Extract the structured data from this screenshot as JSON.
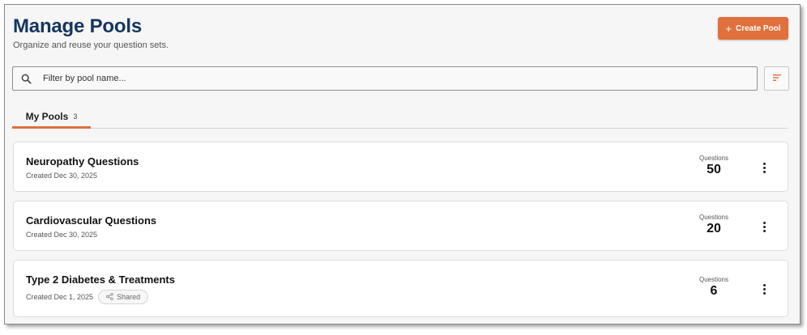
{
  "header": {
    "title": "Manage Pools",
    "subtitle": "Organize and reuse your question sets.",
    "create_button": "Create Pool"
  },
  "search": {
    "placeholder": "Filter by pool name..."
  },
  "tabs": [
    {
      "label": "My Pools",
      "count": "3"
    }
  ],
  "pools": [
    {
      "name": "Neuropathy Questions",
      "created": "Created Dec 30, 2025",
      "questions_label": "Questions",
      "questions": "50",
      "shared": false
    },
    {
      "name": "Cardiovascular Questions",
      "created": "Created Dec 30, 2025",
      "questions_label": "Questions",
      "questions": "20",
      "shared": false
    },
    {
      "name": "Type 2 Diabetes & Treatments",
      "created": "Created Dec 1, 2025",
      "questions_label": "Questions",
      "questions": "6",
      "shared": true,
      "shared_label": "Shared"
    }
  ],
  "colors": {
    "accent": "#e0703c",
    "title": "#14365f"
  }
}
